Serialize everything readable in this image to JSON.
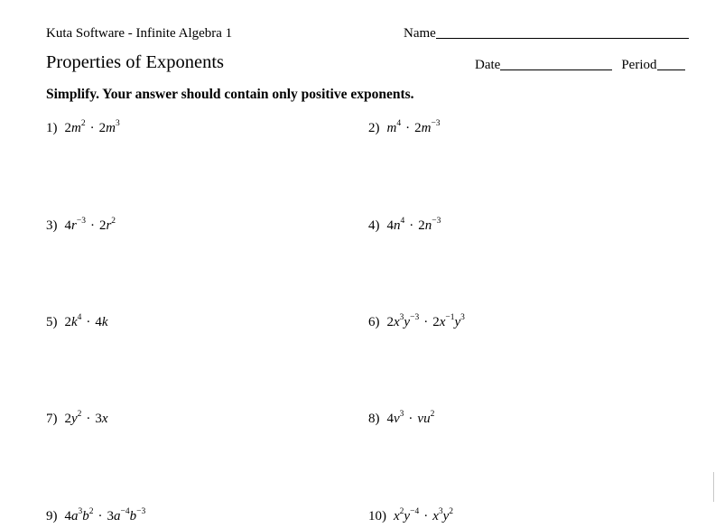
{
  "header": {
    "source": "Kuta Software - Infinite Algebra 1",
    "name_label": "Name",
    "title": "Properties of Exponents",
    "date_label": "Date",
    "period_label": "Period"
  },
  "instructions": "Simplify.  Your answer should contain only positive exponents.",
  "problems": [
    {
      "number": "1)",
      "terms": [
        [
          {
            "t": "2"
          },
          {
            "v": "m"
          },
          {
            "s": "2"
          }
        ],
        [
          {
            "t": "2"
          },
          {
            "v": "m"
          },
          {
            "s": "3"
          }
        ]
      ],
      "text": "2m^2 · 2m^3"
    },
    {
      "number": "2)",
      "terms": [
        [
          {
            "v": "m"
          },
          {
            "s": "4"
          }
        ],
        [
          {
            "t": "2"
          },
          {
            "v": "m"
          },
          {
            "s": "−3"
          }
        ]
      ],
      "text": "m^4 · 2m^-3"
    },
    {
      "number": "3)",
      "terms": [
        [
          {
            "t": "4"
          },
          {
            "v": "r"
          },
          {
            "s": "−3"
          }
        ],
        [
          {
            "t": "2"
          },
          {
            "v": "r"
          },
          {
            "s": "2"
          }
        ]
      ],
      "text": "4r^-3 · 2r^2"
    },
    {
      "number": "4)",
      "terms": [
        [
          {
            "t": "4"
          },
          {
            "v": "n"
          },
          {
            "s": "4"
          }
        ],
        [
          {
            "t": "2"
          },
          {
            "v": "n"
          },
          {
            "s": "−3"
          }
        ]
      ],
      "text": "4n^4 · 2n^-3"
    },
    {
      "number": "5)",
      "terms": [
        [
          {
            "t": "2"
          },
          {
            "v": "k"
          },
          {
            "s": "4"
          }
        ],
        [
          {
            "t": "4"
          },
          {
            "v": "k"
          }
        ]
      ],
      "text": "2k^4 · 4k"
    },
    {
      "number": "6)",
      "terms": [
        [
          {
            "t": "2"
          },
          {
            "v": "x"
          },
          {
            "s": "3"
          },
          {
            "v": "y"
          },
          {
            "s": "−3"
          }
        ],
        [
          {
            "t": "2"
          },
          {
            "v": "x"
          },
          {
            "s": "−1"
          },
          {
            "v": "y"
          },
          {
            "s": "3"
          }
        ]
      ],
      "text": "2x^3y^-3 · 2x^-1y^3"
    },
    {
      "number": "7)",
      "terms": [
        [
          {
            "t": "2"
          },
          {
            "v": "y"
          },
          {
            "s": "2"
          }
        ],
        [
          {
            "t": "3"
          },
          {
            "v": "x"
          }
        ]
      ],
      "text": "2y^2 · 3x"
    },
    {
      "number": "8)",
      "terms": [
        [
          {
            "t": "4"
          },
          {
            "v": "v"
          },
          {
            "s": "3"
          }
        ],
        [
          {
            "v": "vu"
          },
          {
            "s": "2"
          }
        ]
      ],
      "text": "4v^3 · vu^2"
    },
    {
      "number": "9)",
      "terms": [
        [
          {
            "t": "4"
          },
          {
            "v": "a"
          },
          {
            "s": "3"
          },
          {
            "v": "b"
          },
          {
            "s": "2"
          }
        ],
        [
          {
            "t": "3"
          },
          {
            "v": "a"
          },
          {
            "s": "−4"
          },
          {
            "v": "b"
          },
          {
            "s": "−3"
          }
        ]
      ],
      "text": "4a^3b^2 · 3a^-4b^-3"
    },
    {
      "number": "10)",
      "terms": [
        [
          {
            "v": "x"
          },
          {
            "s": "2"
          },
          {
            "v": "y"
          },
          {
            "s": "−4"
          }
        ],
        [
          {
            "v": "x"
          },
          {
            "s": "3"
          },
          {
            "v": "y"
          },
          {
            "s": "2"
          }
        ]
      ],
      "text": "x^2y^-4 · x^3y^2"
    }
  ],
  "operator": "·"
}
